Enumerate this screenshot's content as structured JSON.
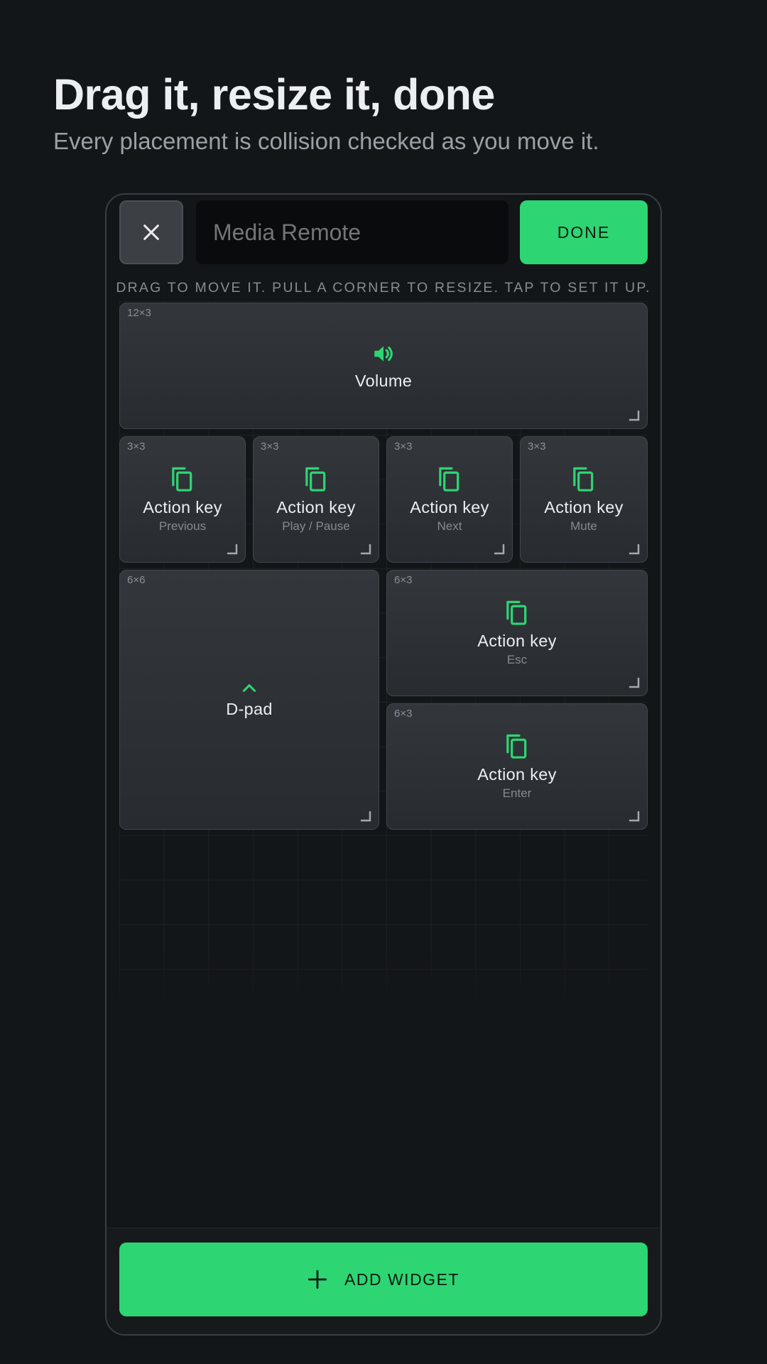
{
  "header": {
    "title": "Drag it, resize it, done",
    "subtitle": "Every placement is collision checked as you move it."
  },
  "editor": {
    "close_icon": "close-icon",
    "name_placeholder": "Media Remote",
    "done_label": "DONE",
    "hint": "DRAG TO MOVE IT. PULL A CORNER TO RESIZE. TAP TO SET IT UP."
  },
  "widgets": [
    {
      "size": "12×3",
      "icon": "volume-icon",
      "label": "Volume",
      "sub": ""
    },
    {
      "size": "3×3",
      "icon": "copy-icon",
      "label": "Action key",
      "sub": "Previous"
    },
    {
      "size": "3×3",
      "icon": "copy-icon",
      "label": "Action key",
      "sub": "Play / Pause"
    },
    {
      "size": "3×3",
      "icon": "copy-icon",
      "label": "Action key",
      "sub": "Next"
    },
    {
      "size": "3×3",
      "icon": "copy-icon",
      "label": "Action key",
      "sub": "Mute"
    },
    {
      "size": "6×6",
      "icon": "chevron-up-icon",
      "label": "D-pad",
      "sub": ""
    },
    {
      "size": "6×3",
      "icon": "copy-icon",
      "label": "Action key",
      "sub": "Esc"
    },
    {
      "size": "6×3",
      "icon": "copy-icon",
      "label": "Action key",
      "sub": "Enter"
    }
  ],
  "footer": {
    "add_label": "ADD WIDGET",
    "add_icon": "plus-icon"
  },
  "colors": {
    "accent": "#2ed573",
    "background": "#131619",
    "tile": "#2e3236"
  }
}
